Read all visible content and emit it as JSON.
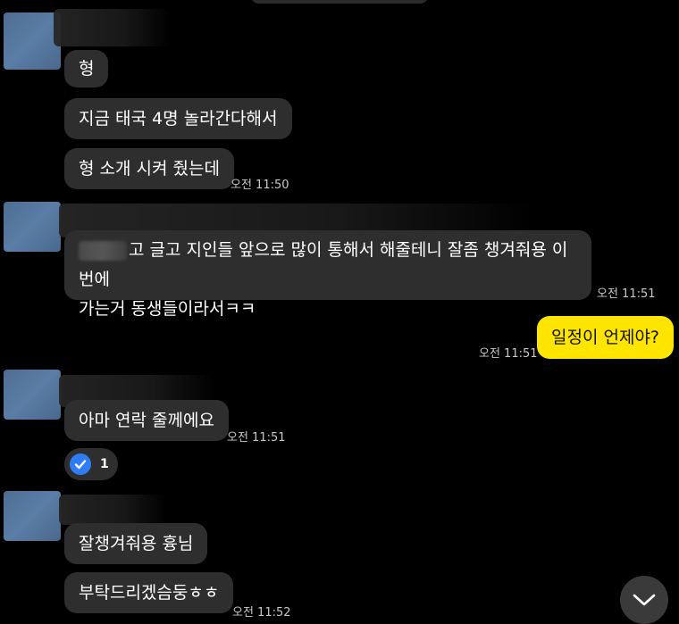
{
  "messages": {
    "m1": "형",
    "m2": "지금 태국 4명 놀라간다해서",
    "m3": "형 소개 시켜 줬는데",
    "t1": "오전 11:50",
    "m4_line1": "고 글고 지인들 앞으로 많이 통해서 해줄테니 잘좀 챙겨줘용 이번에",
    "m4_line2": "가는거 동생들이라서ㅋㅋ",
    "t2": "오전 11:51",
    "mine1": "일정이 언제야?",
    "t3": "오전 11:51",
    "m5": "아마 연락 줄께에요",
    "t4": "오전 11:51",
    "reaction_count": "1",
    "m6": "잘챙겨줘용 흉님",
    "m7": "부탁드리겠슴둥ㅎㅎ",
    "t5": "오전 11:52"
  },
  "colors": {
    "background": "#000000",
    "incoming_bubble": "#2e2e2e",
    "outgoing_bubble": "#fee500",
    "reaction_check": "#2f7df6"
  },
  "icons": {
    "reaction": "check-circle-icon",
    "scroll": "chevron-down-icon"
  }
}
